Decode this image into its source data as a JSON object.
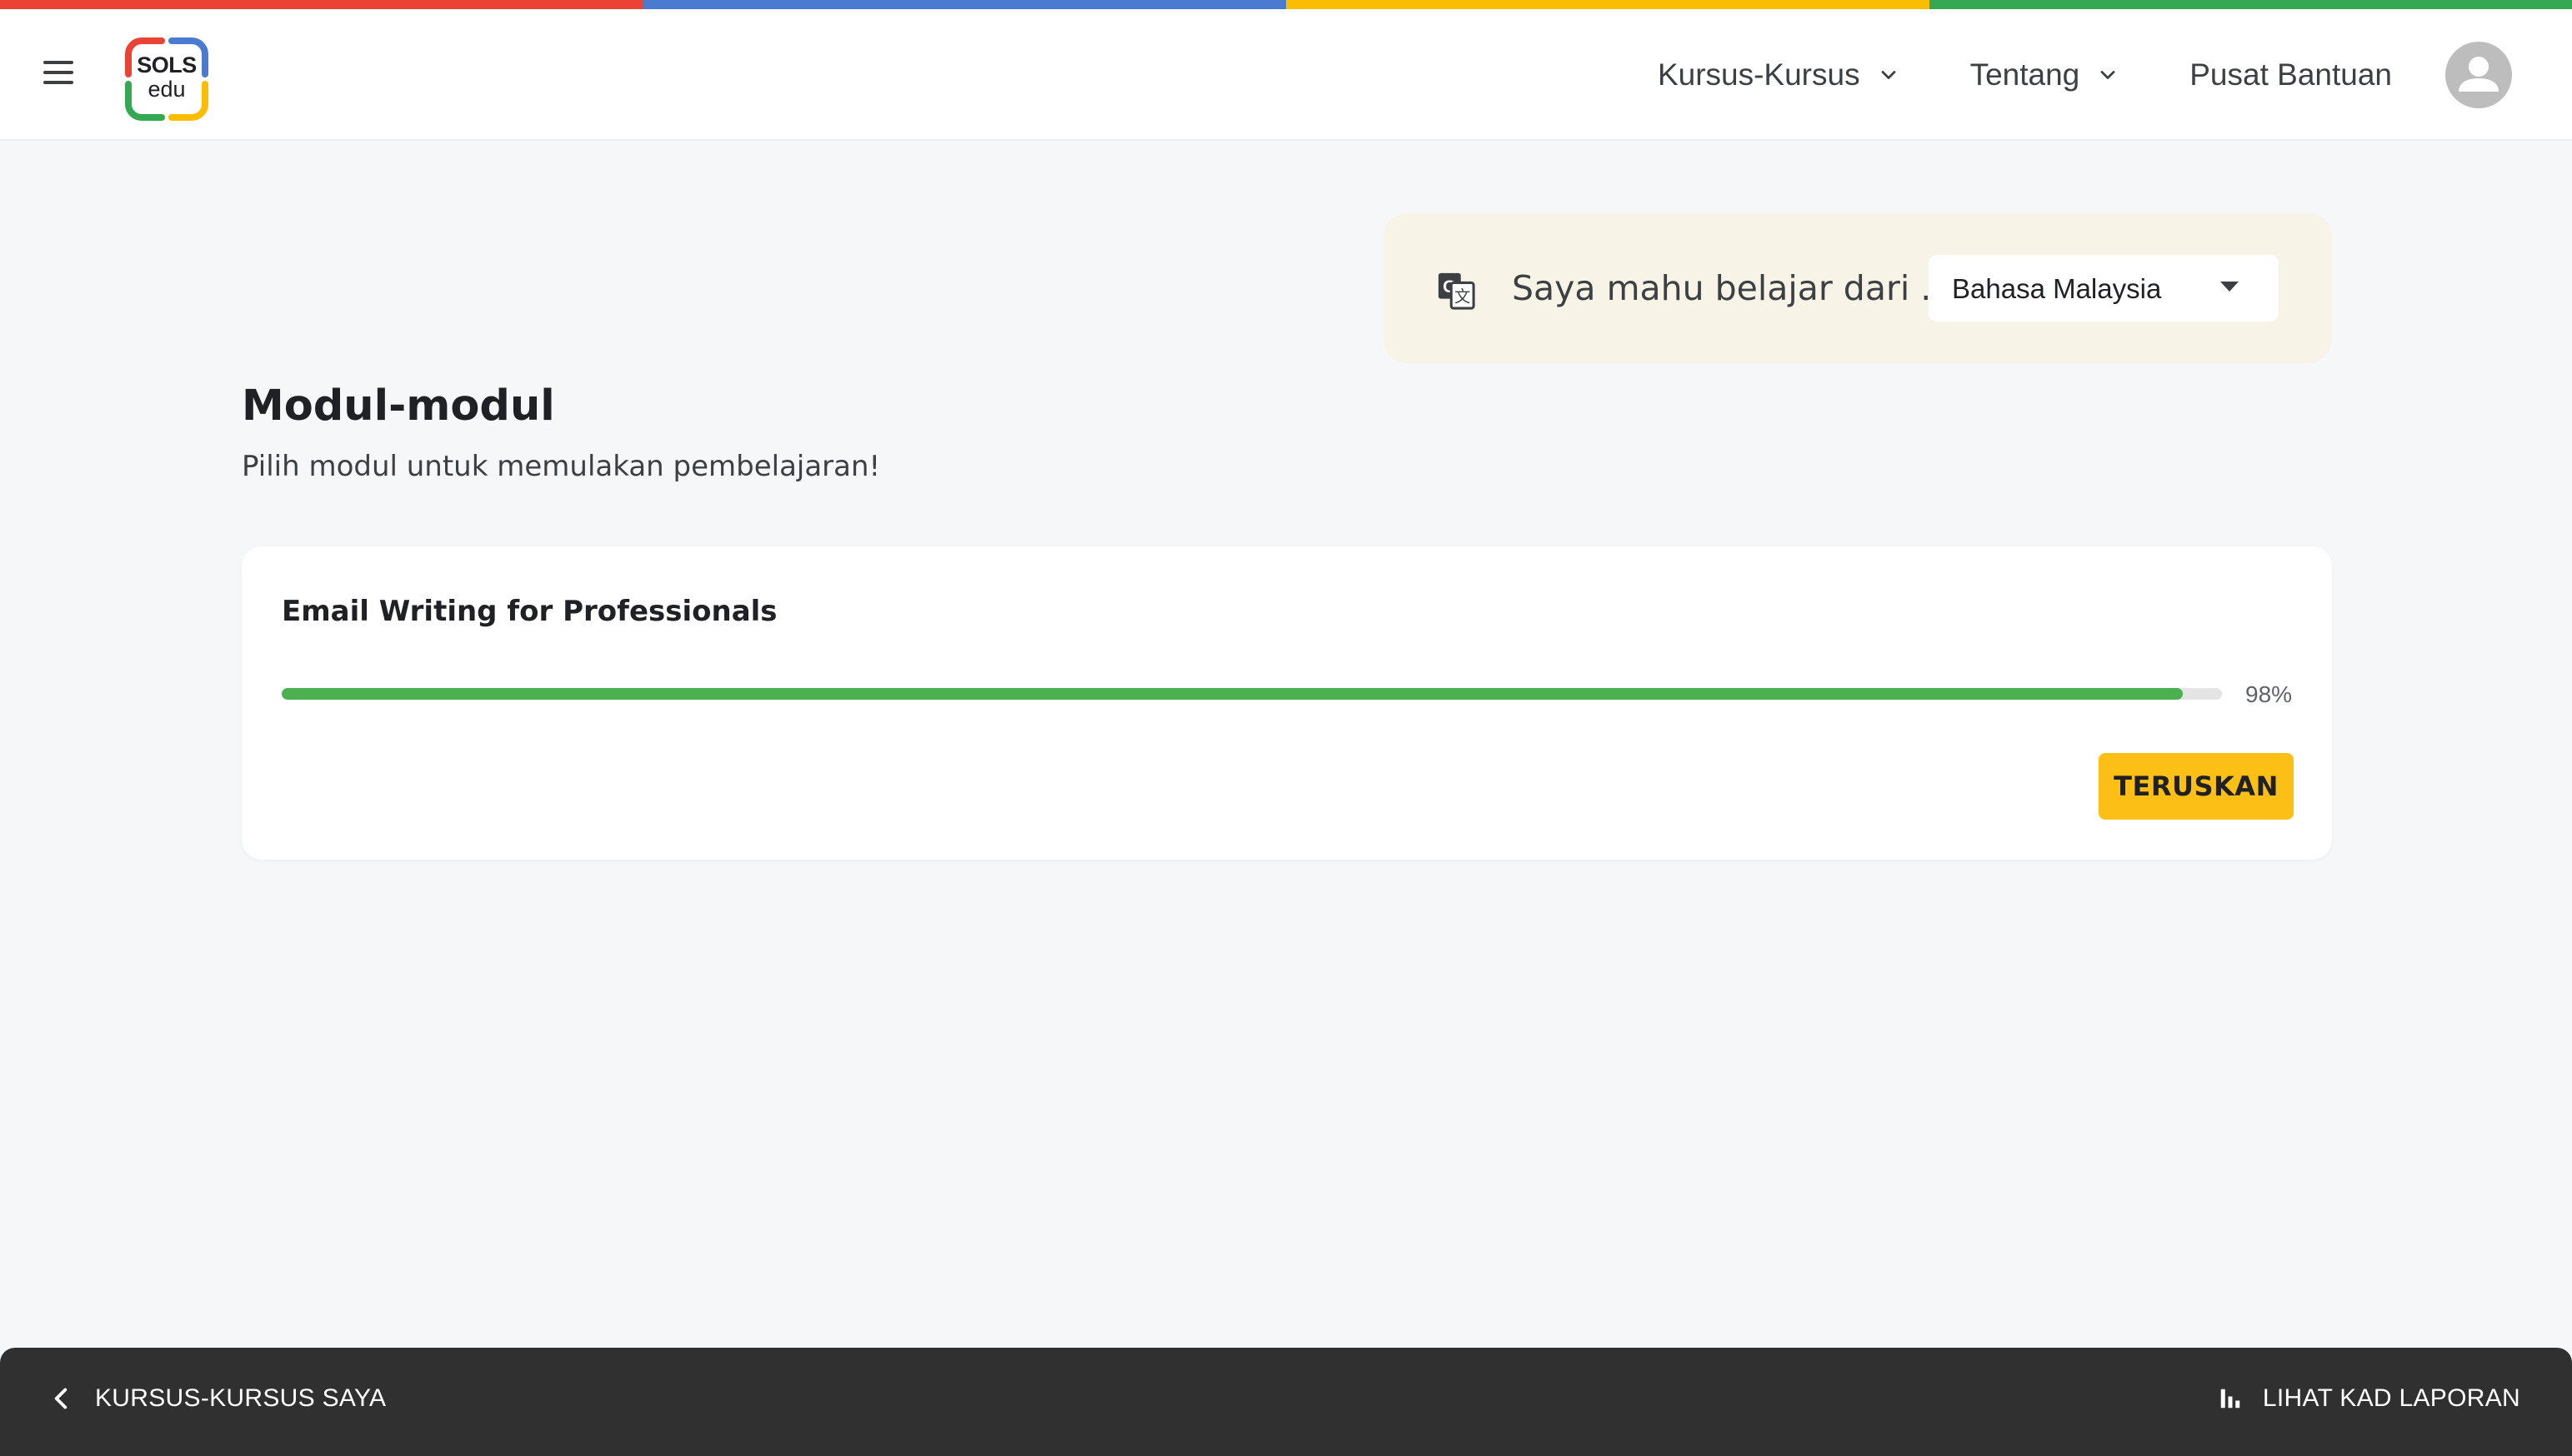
{
  "colors": {
    "strip": [
      "#ea4335",
      "#4a7bd0",
      "#fbbc04",
      "#34a853"
    ],
    "accent_button": "#fbbf15",
    "progress": "#4caf50",
    "bottom_bar": "#303030"
  },
  "header": {
    "menu_icon": "hamburger-menu-icon",
    "logo": {
      "line1": "SOLS",
      "line2": "edu"
    },
    "nav": [
      {
        "label": "Kursus-Kursus",
        "icon": "chevron-down-icon"
      },
      {
        "label": "Tentang",
        "icon": "chevron-down-icon"
      },
      {
        "label": "Pusat Bantuan"
      }
    ],
    "avatar_icon": "user-avatar-icon"
  },
  "language": {
    "icon": "translate-icon",
    "label": "Saya mahu belajar dari ...",
    "selected": "Bahasa Malaysia"
  },
  "modules": {
    "title": "Modul-modul",
    "subtitle": "Pilih modul untuk memulakan pembelajaran!",
    "items": [
      {
        "title": "Email Writing for Professionals",
        "progress": 0.98,
        "progress_label": "98%",
        "button_label": "TERUSKAN"
      }
    ]
  },
  "bottom_bar": {
    "back_label": "KURSUS-KURSUS SAYA",
    "back_icon": "chevron-left-icon",
    "report_label": "LIHAT KAD LAPORAN",
    "report_icon": "bar-chart-icon"
  }
}
